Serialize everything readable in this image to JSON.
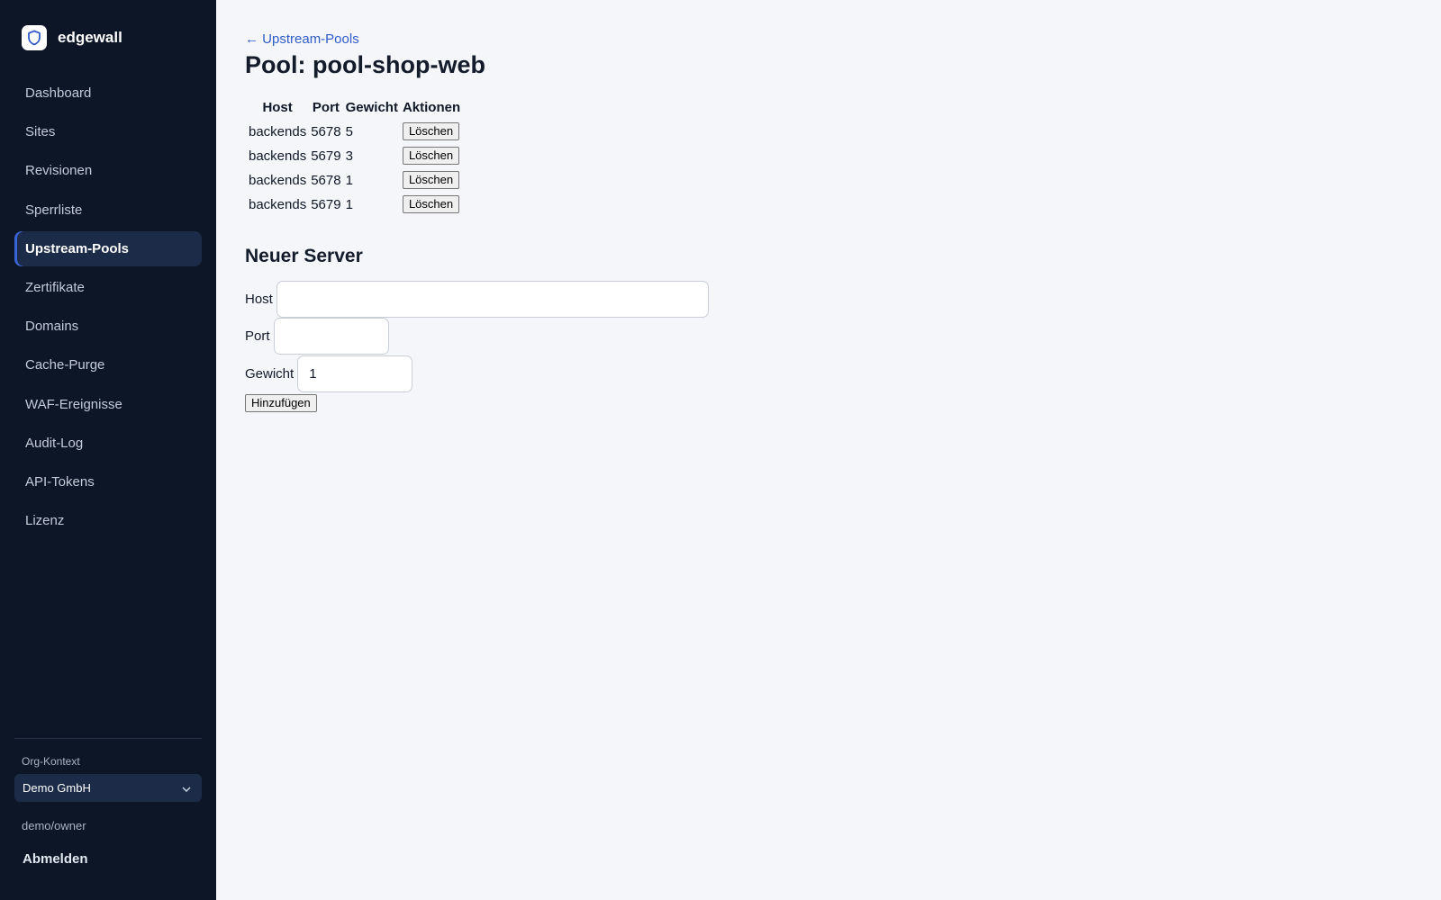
{
  "brand": {
    "name": "edgewall",
    "logo_icon": "shield-icon"
  },
  "sidebar": {
    "items": [
      {
        "label": "Dashboard",
        "active": false
      },
      {
        "label": "Sites",
        "active": false
      },
      {
        "label": "Revisionen",
        "active": false
      },
      {
        "label": "Sperrliste",
        "active": false
      },
      {
        "label": "Upstream-Pools",
        "active": true
      },
      {
        "label": "Zertifikate",
        "active": false
      },
      {
        "label": "Domains",
        "active": false
      },
      {
        "label": "Cache-Purge",
        "active": false
      },
      {
        "label": "WAF-Ereignisse",
        "active": false
      },
      {
        "label": "Audit-Log",
        "active": false
      },
      {
        "label": "API-Tokens",
        "active": false
      },
      {
        "label": "Lizenz",
        "active": false
      }
    ],
    "org_label": "Org-Kontext",
    "org_value": "Demo GmbH",
    "user": "demo/owner",
    "logout": "Abmelden"
  },
  "main": {
    "back_link": "← Upstream-Pools",
    "title": "Pool: pool-shop-web",
    "table": {
      "headers": [
        "Host",
        "Port",
        "Gewicht",
        "Aktionen"
      ],
      "rows": [
        {
          "host": "backends",
          "port": "5678",
          "weight": "5",
          "action": "Löschen"
        },
        {
          "host": "backends",
          "port": "5679",
          "weight": "3",
          "action": "Löschen"
        },
        {
          "host": "backends",
          "port": "5678",
          "weight": "1",
          "action": "Löschen"
        },
        {
          "host": "backends",
          "port": "5679",
          "weight": "1",
          "action": "Löschen"
        }
      ]
    },
    "form": {
      "title": "Neuer Server",
      "host_label": "Host",
      "host_value": "",
      "port_label": "Port",
      "port_value": "",
      "weight_label": "Gewicht",
      "weight_value": "1",
      "submit": "Hinzufügen"
    }
  },
  "colors": {
    "sidebar_bg": "#0d1627",
    "active_bg": "#1c2b47",
    "accent": "#3b63d8",
    "link": "#2f5cc7",
    "page_bg": "#f4f6fa"
  }
}
